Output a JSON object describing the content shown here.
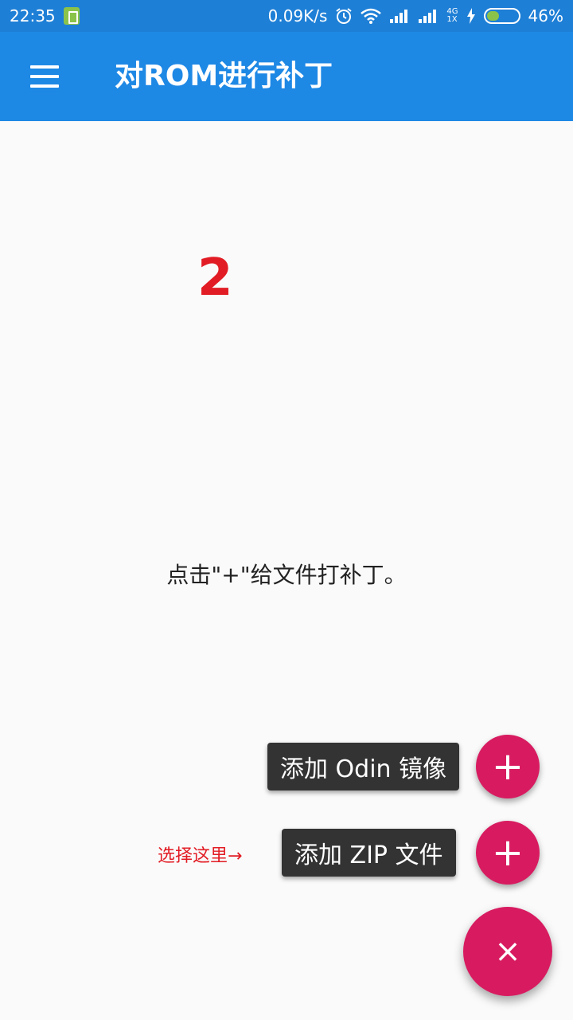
{
  "status_bar": {
    "time": "22:35",
    "net_speed": "0.09K/s",
    "network_small_top": "4G",
    "network_small_bottom": "1X",
    "battery_percent": "46%",
    "battery_level": 0.46
  },
  "app_bar": {
    "title": "对ROM进行补丁"
  },
  "main": {
    "step_number": "2",
    "hint": "点击\"+\"给文件打补丁。"
  },
  "fab_menu": {
    "odin_label": "添加 Odin 镜像",
    "zip_label": "添加 ZIP 文件",
    "select_hint": "选择这里→",
    "plus_glyph": "+",
    "close_glyph": "×"
  },
  "colors": {
    "app_bar": "#1e88e5",
    "status_bar": "#1e7fd6",
    "fab": "#d81b60",
    "annotation_red": "#e21c24"
  }
}
